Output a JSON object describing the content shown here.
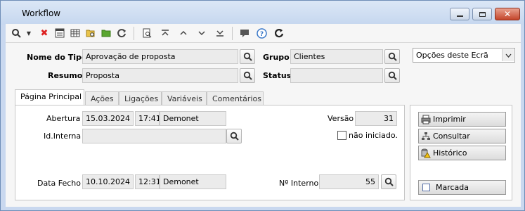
{
  "window": {
    "title": "Workflow"
  },
  "header": {
    "tipo_label": "Nome do Tipo",
    "tipo_value": "Aprovação de proposta",
    "resumo_label": "Resumo",
    "resumo_value": "Proposta",
    "grupo_label": "Grupo",
    "grupo_value": "Clientes",
    "status_label": "Status",
    "status_value": "",
    "options_select": "Opções deste Ecrã"
  },
  "tabs": [
    {
      "label": "Página Principal"
    },
    {
      "label": "Ações"
    },
    {
      "label": "Ligações"
    },
    {
      "label": "Variáveis"
    },
    {
      "label": "Comentários"
    }
  ],
  "main": {
    "abertura_label": "Abertura",
    "abertura_date": "15.03.2024",
    "abertura_time": "17:41",
    "abertura_user": "Demonet",
    "versao_label": "Versão",
    "versao_value": "31",
    "idinterna_label": "Id.Interna",
    "idinterna_value": "",
    "nao_iniciado_label": "não iniciado.",
    "nao_iniciado_checked": false,
    "fecho_label": "Data Fecho",
    "fecho_date": "10.10.2024",
    "fecho_time": "12:31",
    "fecho_user": "Demonet",
    "ninterno_label": "Nº Interno",
    "ninterno_value": "55"
  },
  "side": {
    "imprimir": "Imprimir",
    "consultar": "Consultar",
    "historico": "Histórico",
    "marcada": "Marcada",
    "marcada_checked": false
  }
}
